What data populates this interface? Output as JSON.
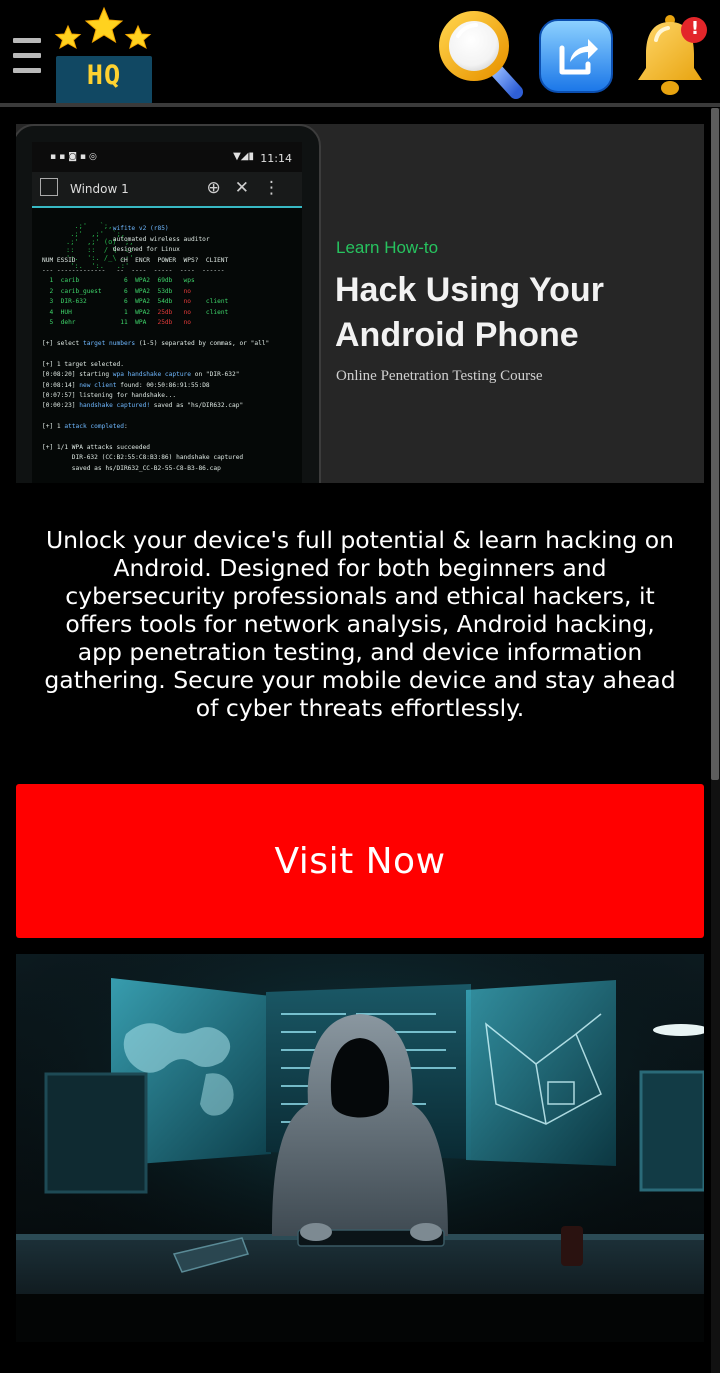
{
  "header": {
    "logo_text": "HQ",
    "notification_badge": "!"
  },
  "banner": {
    "kicker": "Learn How-to",
    "title": "Hack Using Your Android Phone",
    "subtitle": "Online Penetration Testing Course",
    "phone": {
      "time": "11:14",
      "window_title": "Window 1"
    }
  },
  "description": "Unlock your device's full potential & learn hacking on Android. Designed for both beginners and cybersecurity professionals and ethical hackers, it offers tools for network analysis, Android hacking, app penetration testing, and device information gathering. Secure your mobile device and stay ahead of cyber threats effortlessly.",
  "cta": {
    "label": "Visit Now",
    "color": "#ff0000"
  },
  "colors": {
    "background": "#000000",
    "logo_box": "#114863",
    "logo_text": "#ffd230",
    "kicker": "#27c35f"
  },
  "icons": [
    "menu-icon",
    "star-icon",
    "search-icon",
    "share-icon",
    "bell-icon"
  ]
}
